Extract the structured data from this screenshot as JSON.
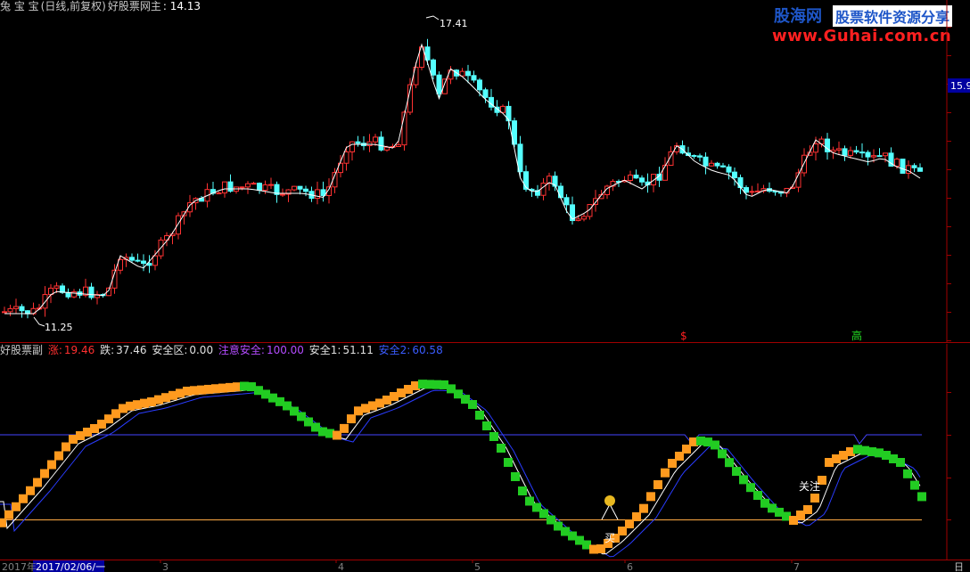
{
  "main_header": {
    "app_name": "兔 宝 宝",
    "mode": "(日线,前复权)",
    "indicator_name": "好股票网主",
    "indicator_value": ": 14.13"
  },
  "main_chart": {
    "high_label": "17.41",
    "low_label": "11.25",
    "price_badge": "15.9",
    "marker_s": "$",
    "marker_high": "高",
    "colors": {
      "up": "#ff3232",
      "down": "#54ffff",
      "ma": "#ffffff"
    }
  },
  "sub_header": {
    "name": "好股票副",
    "zhang_label": "涨:",
    "zhang_value": "19.46",
    "die_label": "跌:",
    "die_value": "37.46",
    "anquanqu_label": "安全区:",
    "anquanqu_value": "0.00",
    "zhuyi_label": "注意安全:",
    "zhuyi_value": "100.00",
    "anquan1_label": "安全1:",
    "anquan1_value": "51.11",
    "anquan2_label": "安全2:",
    "anquan2_value": "60.58"
  },
  "sub_chart": {
    "annotations": {
      "mairu": "买",
      "guanzhu": "关注"
    },
    "colors": {
      "rise": "#ff9a1e",
      "fall": "#22cc22",
      "line1": "#ffffff",
      "line2": "#2a3cff",
      "upper": "#4444ff",
      "lower": "#ffaa44"
    }
  },
  "time_axis": {
    "labels": [
      "2017年",
      "2017/02/06/一",
      "3",
      "4",
      "5",
      "6",
      "7",
      "日"
    ]
  },
  "watermark": {
    "brand": "股海网",
    "slogan": "股票软件资源分享",
    "url": "www.Guhai.com.cn"
  }
}
